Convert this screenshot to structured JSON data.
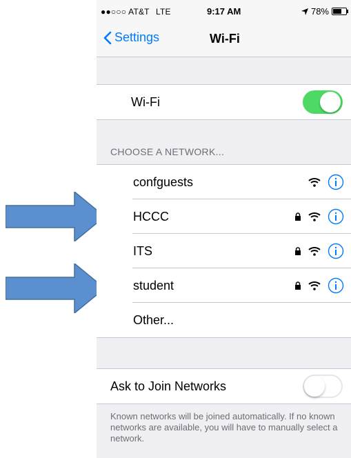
{
  "status_bar": {
    "carrier": "AT&T",
    "network": "LTE",
    "time": "9:17 AM",
    "battery": "78%",
    "battery_level": 0.78
  },
  "nav": {
    "back_label": "Settings",
    "title": "Wi-Fi"
  },
  "wifi_toggle": {
    "label": "Wi-Fi",
    "on": true
  },
  "networks_header": "CHOOSE A NETWORK...",
  "networks": [
    {
      "name": "confguests",
      "locked": false
    },
    {
      "name": "HCCC",
      "locked": true
    },
    {
      "name": "ITS",
      "locked": true
    },
    {
      "name": "student",
      "locked": true
    },
    {
      "name": "Other..."
    }
  ],
  "ask_join": {
    "label": "Ask to Join Networks",
    "on": false,
    "footer": "Known networks will be joined automatically. If no known networks are available, you will have to manually select a network."
  },
  "colors": {
    "accent": "#007aff",
    "toggle_on": "#4cd964",
    "arrow": "#5b8fcf"
  }
}
